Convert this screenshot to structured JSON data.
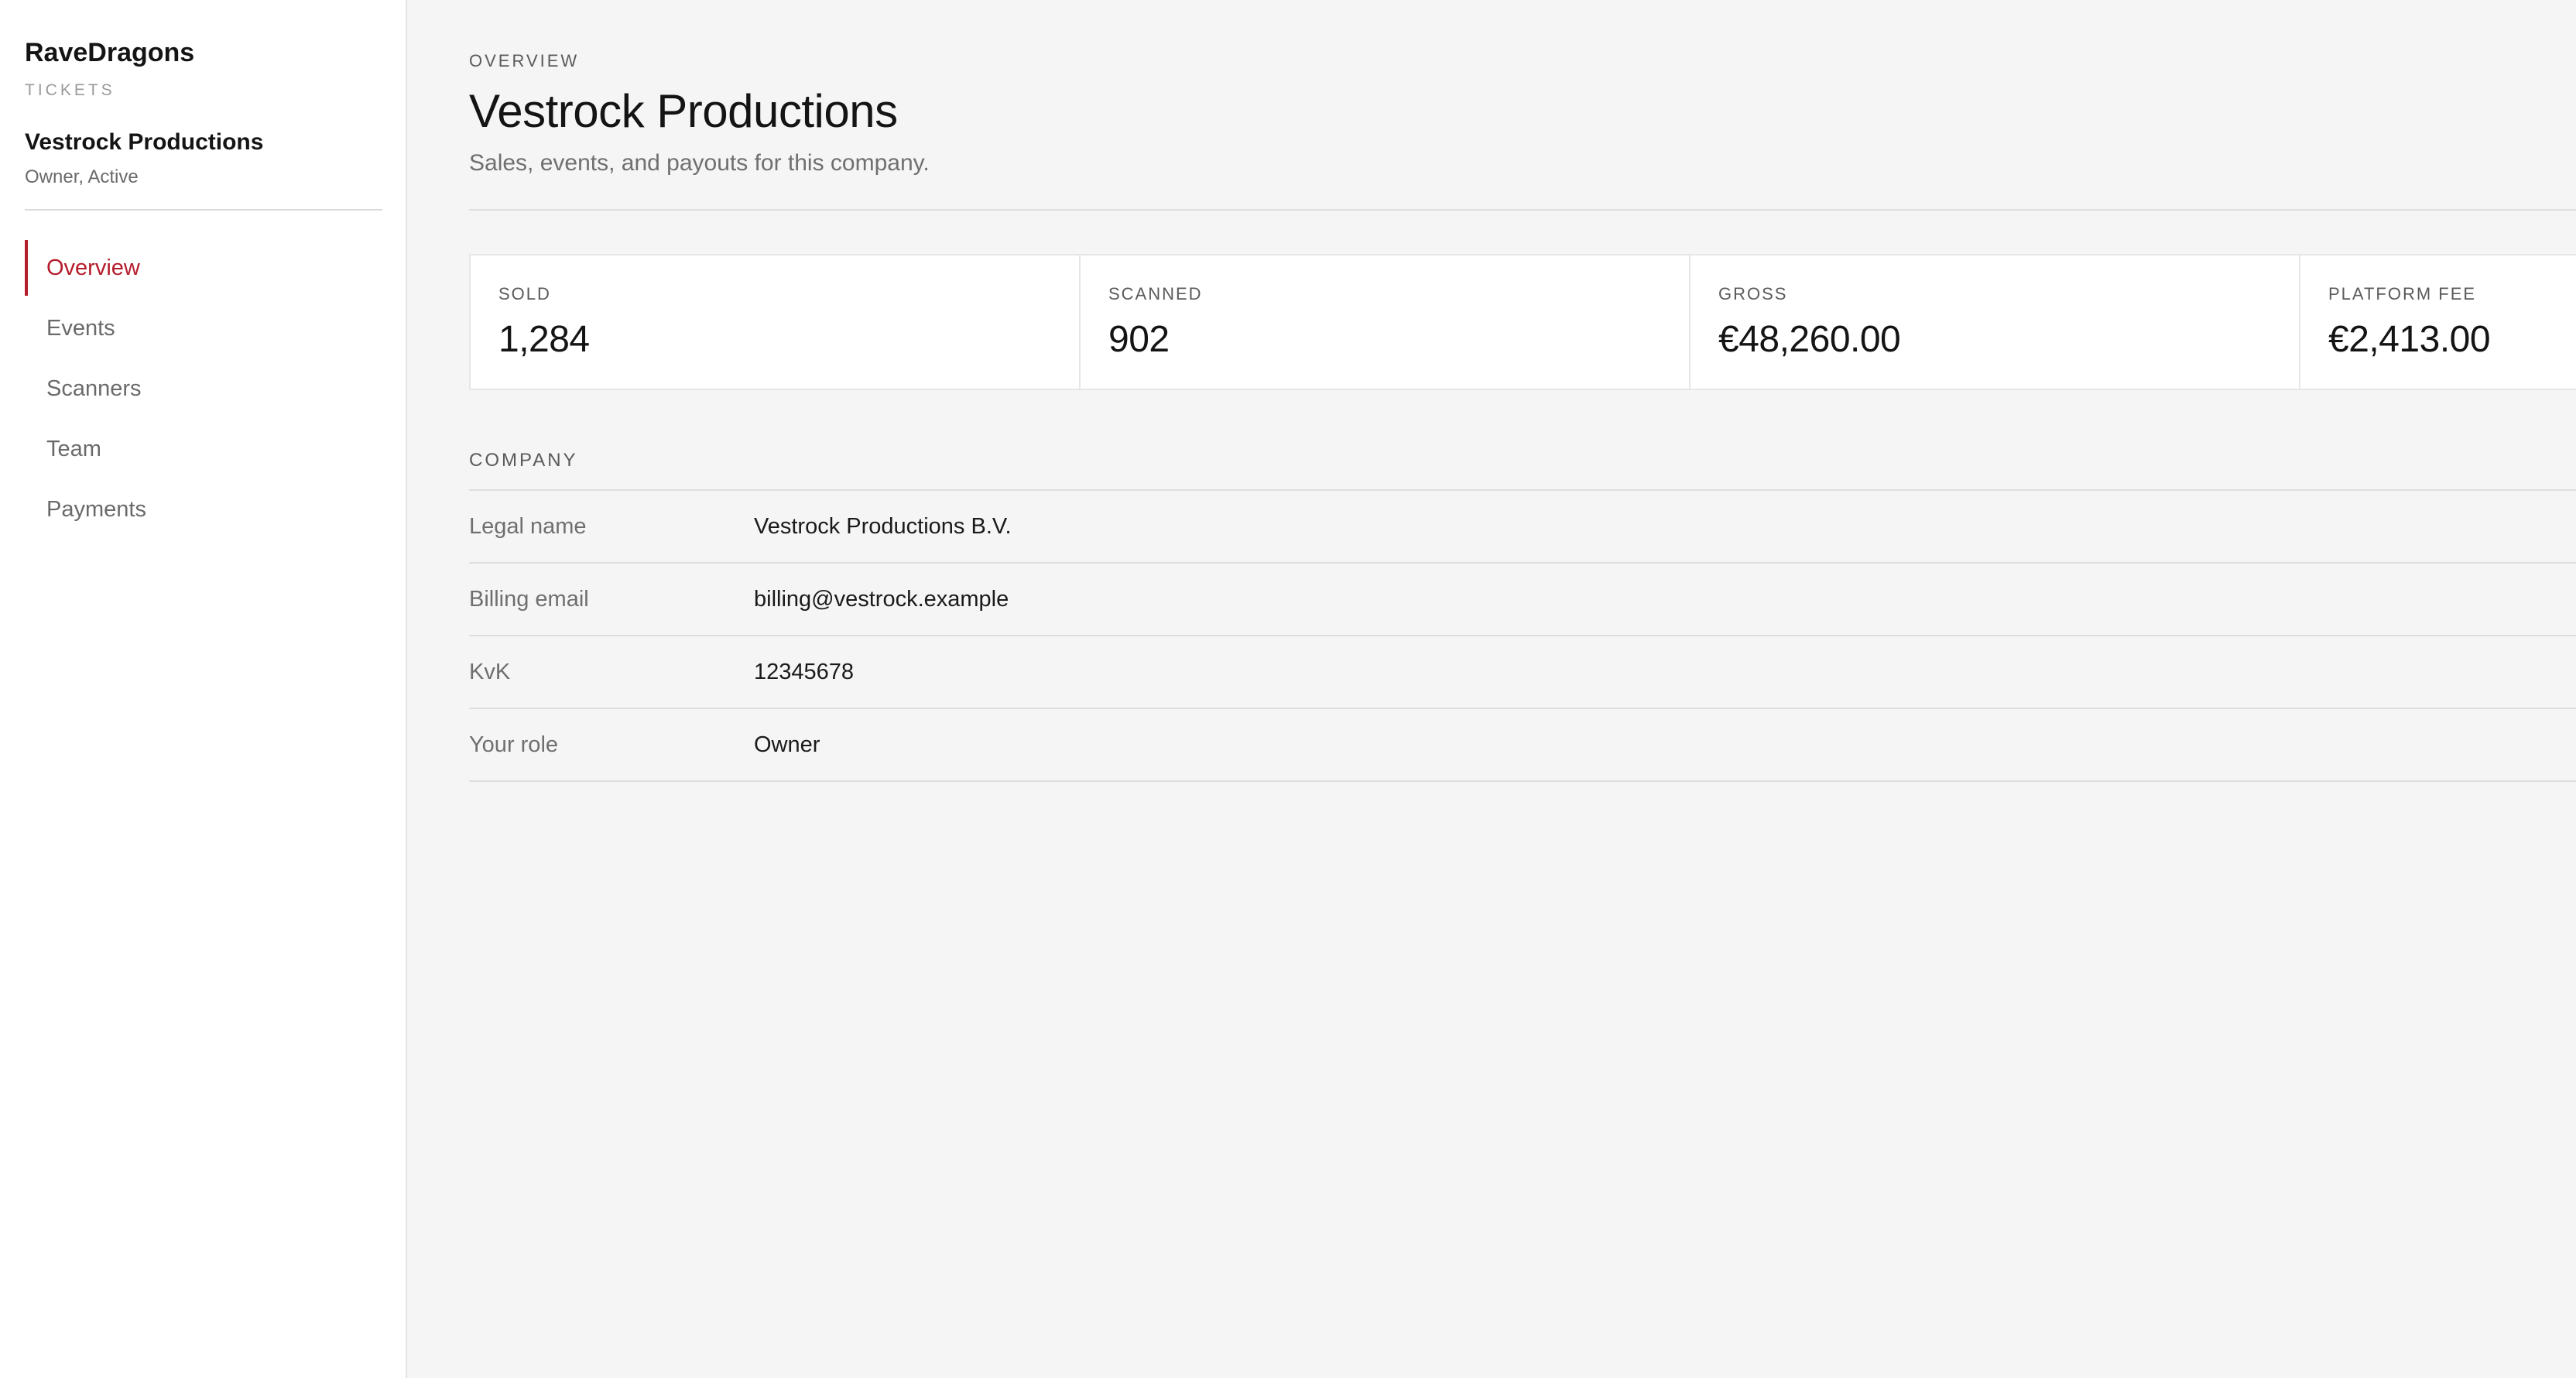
{
  "brand": {
    "name": "RaveDragons",
    "sub": "TICKETS"
  },
  "company": {
    "name": "Vestrock Productions",
    "role": "Owner, Active"
  },
  "nav": [
    {
      "label": "Overview",
      "active": true
    },
    {
      "label": "Events",
      "active": false
    },
    {
      "label": "Scanners",
      "active": false
    },
    {
      "label": "Team",
      "active": false
    },
    {
      "label": "Payments",
      "active": false
    }
  ],
  "header": {
    "eyebrow": "OVERVIEW",
    "title": "Vestrock Productions",
    "subtitle": "Sales, events, and payouts for this company."
  },
  "stats": [
    {
      "label": "SOLD",
      "value": "1,284"
    },
    {
      "label": "SCANNED",
      "value": "902"
    },
    {
      "label": "GROSS",
      "value": "€48,260.00"
    },
    {
      "label": "PLATFORM FEE",
      "value": "€2,413.00"
    }
  ],
  "details": {
    "section_title": "COMPANY",
    "rows": [
      {
        "label": "Legal name",
        "value": "Vestrock Productions B.V."
      },
      {
        "label": "Billing email",
        "value": "billing@vestrock.example"
      },
      {
        "label": "KvK",
        "value": "12345678"
      },
      {
        "label": "Your role",
        "value": "Owner"
      }
    ]
  },
  "colors": {
    "accent": "#b51c2c",
    "background": "#f5f5f5",
    "sidebar": "#ffffff"
  }
}
